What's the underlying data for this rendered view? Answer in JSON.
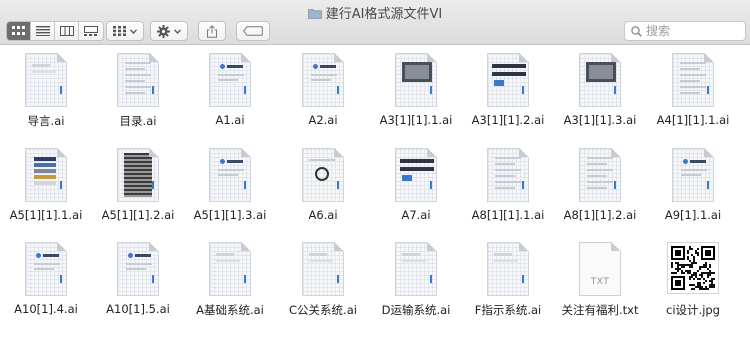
{
  "window": {
    "title": "建行AI格式源文件VI"
  },
  "toolbar": {
    "view_modes": [
      "icon-view",
      "list-view",
      "column-view",
      "gallery-view"
    ],
    "active_view": "icon-view",
    "group_button": "group-by",
    "action_button": "action-menu",
    "share_button": "share",
    "tag_button": "tags",
    "search_placeholder": "搜索"
  },
  "files": [
    {
      "name": "导言.ai",
      "kind": "ai"
    },
    {
      "name": "目录.ai",
      "kind": "ai"
    },
    {
      "name": "A1.ai",
      "kind": "ai"
    },
    {
      "name": "A2.ai",
      "kind": "ai"
    },
    {
      "name": "A3[1][1].1.ai",
      "kind": "ai"
    },
    {
      "name": "A3[1][1].2.ai",
      "kind": "ai"
    },
    {
      "name": "A3[1][1].3.ai",
      "kind": "ai"
    },
    {
      "name": "A4[1][1].1.ai",
      "kind": "ai"
    },
    {
      "name": "A5[1][1].1.ai",
      "kind": "ai"
    },
    {
      "name": "A5[1][1].2.ai",
      "kind": "ai"
    },
    {
      "name": "A5[1][1].3.ai",
      "kind": "ai"
    },
    {
      "name": "A6.ai",
      "kind": "ai"
    },
    {
      "name": "A7.ai",
      "kind": "ai"
    },
    {
      "name": "A8[1][1].1.ai",
      "kind": "ai"
    },
    {
      "name": "A8[1][1].2.ai",
      "kind": "ai"
    },
    {
      "name": "A9[1].1.ai",
      "kind": "ai"
    },
    {
      "name": "A10[1].4.ai",
      "kind": "ai"
    },
    {
      "name": "A10[1].5.ai",
      "kind": "ai"
    },
    {
      "name": "A基础系统.ai",
      "kind": "ai"
    },
    {
      "name": "C公关系统.ai",
      "kind": "ai"
    },
    {
      "name": "D运输系统.ai",
      "kind": "ai"
    },
    {
      "name": "F指示系统.ai",
      "kind": "ai"
    },
    {
      "name": "关注有福利.txt",
      "kind": "txt",
      "badge": "TXT"
    },
    {
      "name": "ci设计.jpg",
      "kind": "jpg"
    }
  ],
  "colors": {
    "accent_blue": "#3c78c8",
    "toolbar_top": "#ececec",
    "toolbar_bottom": "#dcdcdc"
  }
}
